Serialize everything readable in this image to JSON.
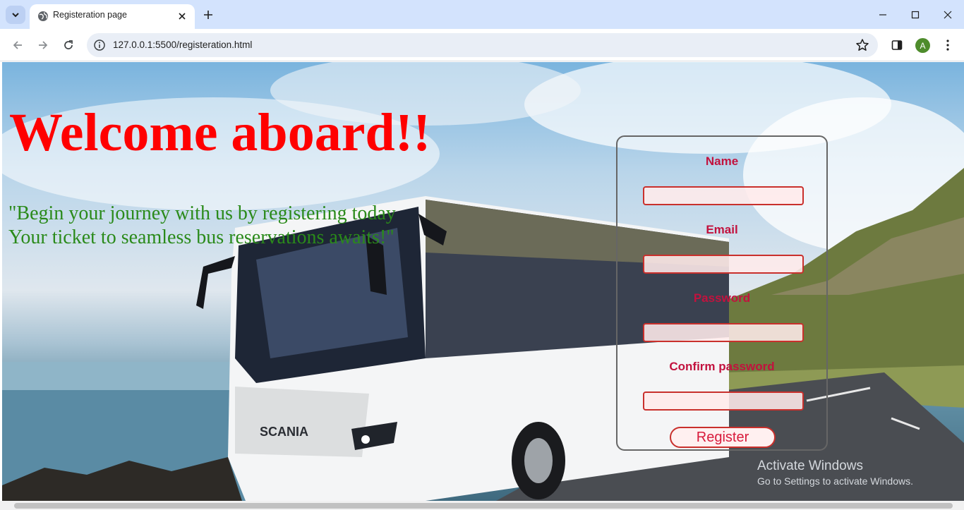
{
  "browser": {
    "tab_title": "Registeration page",
    "url": "127.0.0.1:5500/registeration.html",
    "profile_initial": "A"
  },
  "page": {
    "title": "Welcome aboard!!",
    "quote_line1": "\"Begin your journey with us by registering today",
    "quote_line2": "Your ticket to seamless bus reservations awaits!\""
  },
  "form": {
    "name_label": "Name",
    "email_label": "Email",
    "password_label": "Password",
    "confirm_label": "Confirm password",
    "name_value": "",
    "email_value": "",
    "password_value": "",
    "confirm_value": "",
    "submit_label": "Register"
  },
  "watermark": {
    "title": "Activate Windows",
    "subtitle": "Go to Settings to activate Windows."
  },
  "colors": {
    "title": "#ff0000",
    "quote": "#2a8a1a",
    "label": "#c2123e",
    "input_border": "#c9302c"
  }
}
